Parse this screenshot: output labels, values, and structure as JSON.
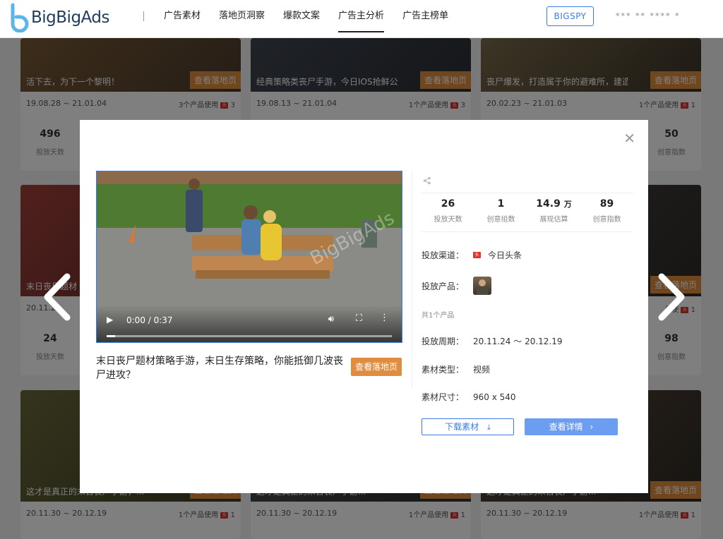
{
  "header": {
    "brand": "BigBigAds",
    "nav": [
      "广告素材",
      "落地页洞察",
      "爆款文案",
      "广告主分析",
      "广告主榜单"
    ],
    "active_nav": "广告主分析",
    "bigspy_label": "BIGSPY",
    "user_label": "*** ** **** *"
  },
  "cards": {
    "row1": [
      {
        "caption": "活下去，为下一个黎明！",
        "land": "查看落地页",
        "date": "19.08.28 ~ 21.01.04",
        "products": "3个产品使用",
        "count": "3",
        "days": "496",
        "days_label": "投放天数"
      },
      {
        "caption": "经典策略类丧尸手游，今日IOS抢鲜公测...",
        "land": "查看落地页",
        "date": "19.08.13 ~ 21.01.04",
        "products": "1个产品使用",
        "count": "3"
      },
      {
        "caption": "丧尸爆发，打造属于你的避难所，建造...",
        "land": "查看落地页",
        "date": "20.02.23 ~ 21.01.03",
        "products": "1个产品使用",
        "count": "1",
        "index": "50",
        "index_label": "创意指数"
      }
    ],
    "row2": [
      {
        "caption": "末日丧尸题材",
        "land": "查看落地页",
        "date": "20.11.2",
        "days": "24",
        "days_label": "投放天数"
      },
      {
        "land": "查看落地页",
        "products": "品使",
        "count": "1",
        "index": "98",
        "index_label": "创意指数"
      }
    ],
    "row3": [
      {
        "caption": "这才是真正的末日丧尸手游，...",
        "land": "查看落地页",
        "date": "20.11.30 ~ 20.12.19",
        "products": "1个产品使用",
        "count": "1"
      },
      {
        "caption": "这才是真正的末日丧尸手游...",
        "land": "查看落地页",
        "date": "20.11.30 ~ 20.12.19",
        "products": "1个产品使用",
        "count": "1"
      },
      {
        "caption": "这才是真正的末日丧尸手游...",
        "land": "查看落地页",
        "date": "20.11.30 ~ 20.12.19",
        "products": "1个产品使用",
        "count": "1"
      }
    ]
  },
  "modal": {
    "watermark": "BigBigAds",
    "video_time": "0:00 / 0:37",
    "video_progress": 0.03,
    "description": "末日丧尸题材策略手游，末日生存策略，你能抵御几波丧尸进攻？",
    "landing_label": "查看落地页",
    "stats": [
      {
        "num": "26",
        "unit": "",
        "label": "投放天数"
      },
      {
        "num": "1",
        "unit": "",
        "label": "创意组数"
      },
      {
        "num": "14.9",
        "unit": "万",
        "label": "展现估算"
      },
      {
        "num": "89",
        "unit": "",
        "label": "创意指数"
      }
    ],
    "channel_label": "投放渠道：",
    "channel_value": "今日头条",
    "product_label": "投放产品：",
    "product_count": "共1个产品",
    "period_label": "投放周期：",
    "period_value": "20.11.24 ～ 20.12.19",
    "type_label": "素材类型：",
    "type_value": "视频",
    "size_label": "素材尺寸：",
    "size_value": "960 x 540",
    "download_label": "下载素材",
    "detail_label": "查看详情"
  },
  "colors": {
    "accent": "#3d7be4",
    "orange": "#e08d3f",
    "detail_btn": "#6b9ef0",
    "toutiao": "#d9352b"
  }
}
